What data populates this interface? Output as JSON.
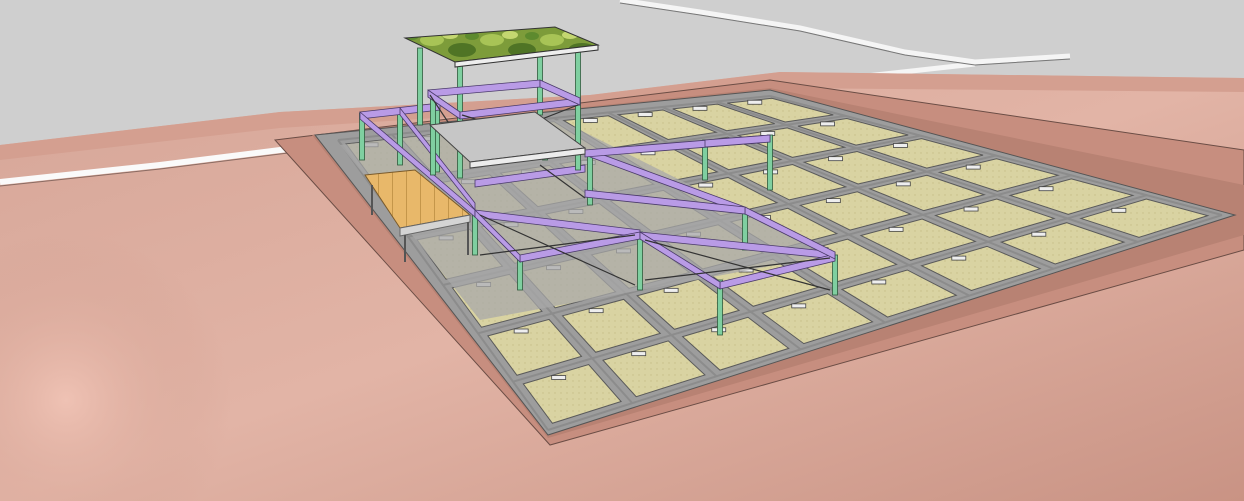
{
  "scene": {
    "kind": "3d-structural-model-render",
    "colors": {
      "sky": "#cfcfcf",
      "terrain": "#dcac9c",
      "terrain_shadow": "#c9968a",
      "pit_edge": "#b58273",
      "pit_floor": "#9a9a9a",
      "slab_panel": "#d9d3a2",
      "slab_gridline": "#6f6f6f",
      "steel_beam": "#b99be6",
      "steel_column": "#7fcfa0",
      "roof_camo_a": "#5b7f2a",
      "roof_camo_b": "#9fbc4c",
      "deck_wood": "#e8b86a",
      "concrete_slab": "#c4c4c4",
      "pipe": "#f4f4f4"
    }
  }
}
